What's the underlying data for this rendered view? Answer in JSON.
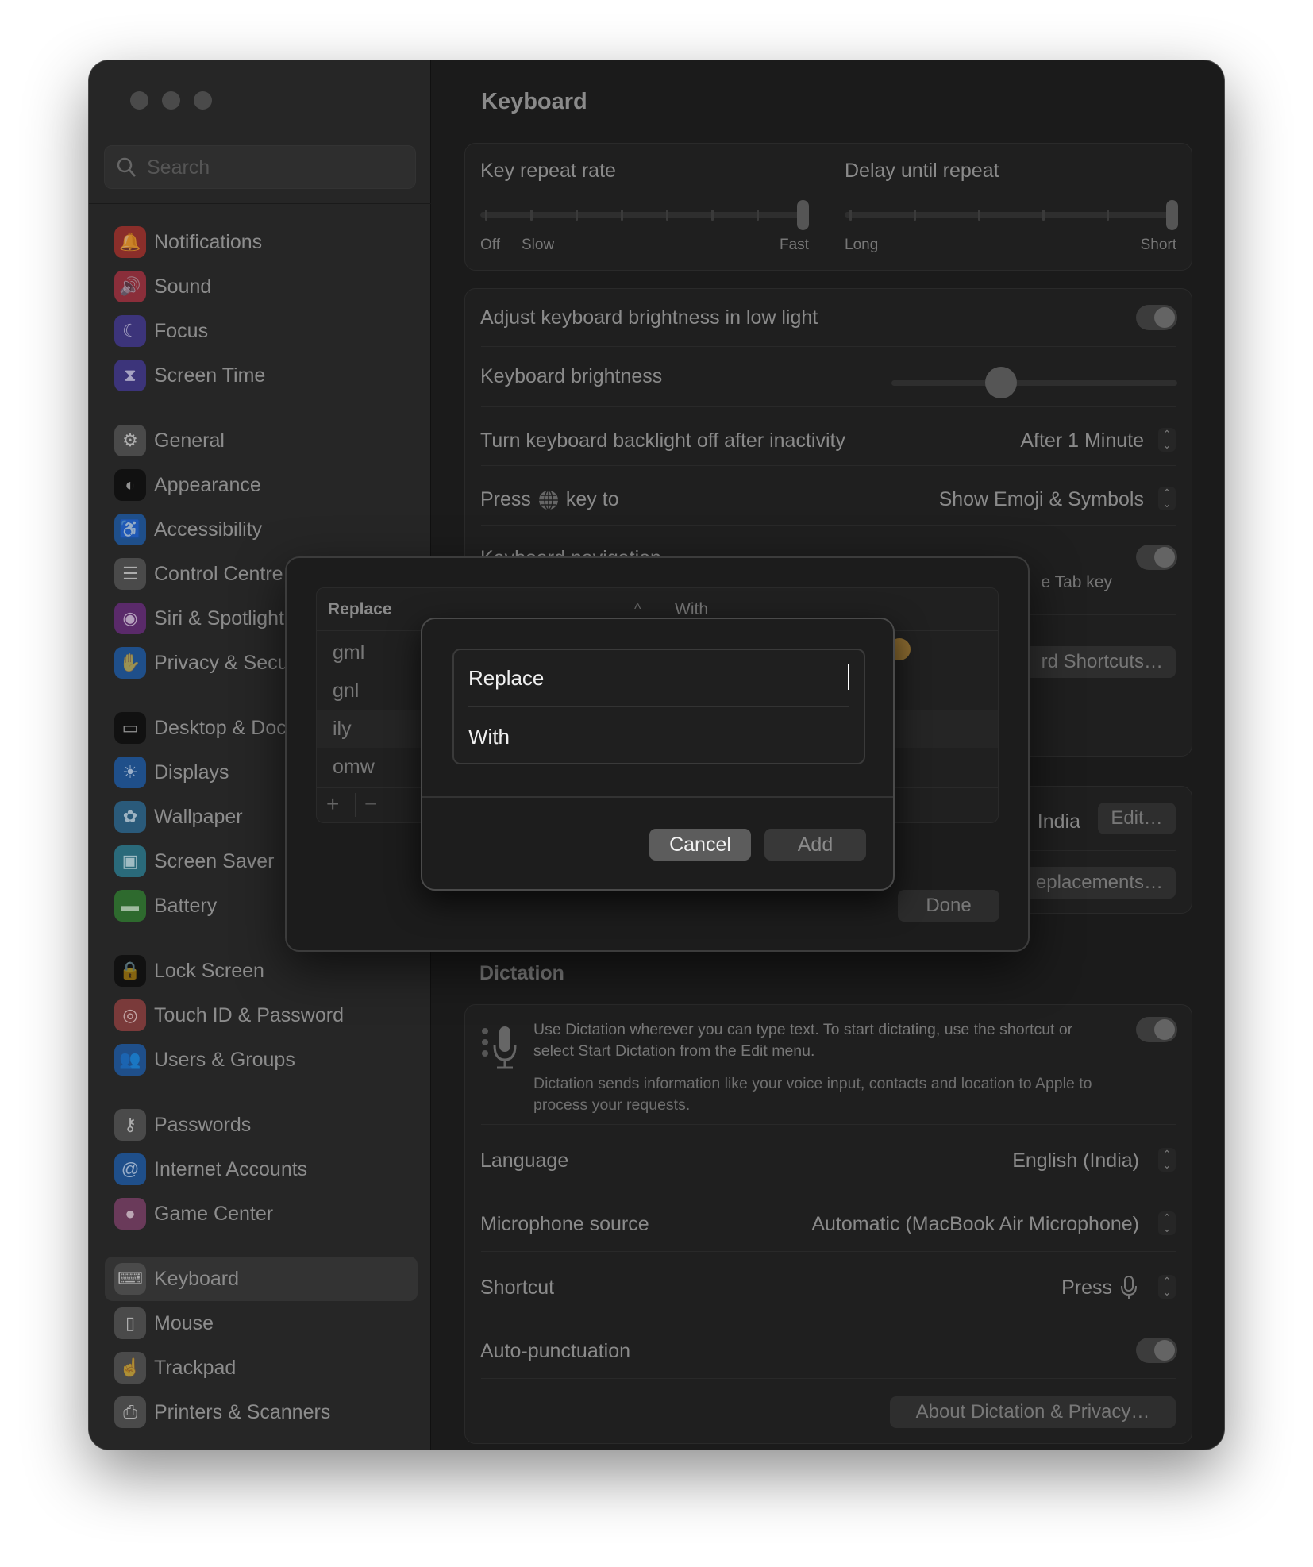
{
  "sidebar": {
    "search_placeholder": "Search",
    "groups": [
      [
        {
          "label": "Notifications",
          "icon": "bell-icon",
          "color": "#8a2e2a",
          "glyph": "🔔"
        },
        {
          "label": "Sound",
          "icon": "speaker-icon",
          "color": "#8a2e3a",
          "glyph": "🔊"
        },
        {
          "label": "Focus",
          "icon": "moon-icon",
          "color": "#3c347a",
          "glyph": "☾"
        },
        {
          "label": "Screen Time",
          "icon": "hourglass-icon",
          "color": "#3c347a",
          "glyph": "⧗"
        }
      ],
      [
        {
          "label": "General",
          "icon": "gear-icon",
          "color": "#4a4a4a",
          "glyph": "⚙"
        },
        {
          "label": "Appearance",
          "icon": "appearance-icon",
          "color": "#111111",
          "glyph": "◐"
        },
        {
          "label": "Accessibility",
          "icon": "accessibility-icon",
          "color": "#1f4f8a",
          "glyph": "♿"
        },
        {
          "label": "Control Centre",
          "icon": "toggles-icon",
          "color": "#4a4a4a",
          "glyph": "☰"
        },
        {
          "label": "Siri & Spotlight",
          "icon": "siri-icon",
          "color": "#5a2a6a",
          "glyph": "◉"
        },
        {
          "label": "Privacy & Security",
          "icon": "hand-icon",
          "color": "#1f4f8a",
          "glyph": "✋"
        }
      ],
      [
        {
          "label": "Desktop & Dock",
          "icon": "dock-icon",
          "color": "#111111",
          "glyph": "▭"
        },
        {
          "label": "Displays",
          "icon": "sun-icon",
          "color": "#1f4f8a",
          "glyph": "☀"
        },
        {
          "label": "Wallpaper",
          "icon": "flower-icon",
          "color": "#2a5a7a",
          "glyph": "✿"
        },
        {
          "label": "Screen Saver",
          "icon": "screensaver-icon",
          "color": "#2a6a7a",
          "glyph": "▣"
        },
        {
          "label": "Battery",
          "icon": "battery-icon",
          "color": "#2e6a2e",
          "glyph": "▬"
        }
      ],
      [
        {
          "label": "Lock Screen",
          "icon": "lock-icon",
          "color": "#111111",
          "glyph": "🔒"
        },
        {
          "label": "Touch ID & Password",
          "icon": "fingerprint-icon",
          "color": "#7a3a3a",
          "glyph": "◎"
        },
        {
          "label": "Users & Groups",
          "icon": "users-icon",
          "color": "#1f4f8a",
          "glyph": "👥"
        }
      ],
      [
        {
          "label": "Passwords",
          "icon": "key-icon",
          "color": "#4a4a4a",
          "glyph": "⚷"
        },
        {
          "label": "Internet Accounts",
          "icon": "at-icon",
          "color": "#1f4f8a",
          "glyph": "@"
        },
        {
          "label": "Game Center",
          "icon": "game-center-icon",
          "color": "#6a3a5a",
          "glyph": "●"
        }
      ],
      [
        {
          "label": "Keyboard",
          "icon": "keyboard-icon",
          "color": "#4a4a4a",
          "glyph": "⌨",
          "selected": true
        },
        {
          "label": "Mouse",
          "icon": "mouse-icon",
          "color": "#4a4a4a",
          "glyph": "▯"
        },
        {
          "label": "Trackpad",
          "icon": "trackpad-icon",
          "color": "#4a4a4a",
          "glyph": "☝"
        },
        {
          "label": "Printers & Scanners",
          "icon": "printer-icon",
          "color": "#4a4a4a",
          "glyph": "⎙"
        }
      ]
    ]
  },
  "main": {
    "title": "Keyboard",
    "key_repeat": {
      "label": "Key repeat rate",
      "min_labels": [
        "Off",
        "Slow"
      ],
      "max_label": "Fast",
      "steps": 8,
      "value_index": 7
    },
    "delay_repeat": {
      "label": "Delay until repeat",
      "min_label": "Long",
      "max_label": "Short",
      "steps": 6,
      "value_index": 5
    },
    "adjust_brightness": {
      "label": "Adjust keyboard brightness in low light",
      "on": true
    },
    "brightness": {
      "label": "Keyboard brightness",
      "value": 0.37
    },
    "backlight_off": {
      "label": "Turn keyboard backlight off after inactivity",
      "value": "After 1 Minute"
    },
    "globe_key": {
      "label_pre": "Press",
      "label_post": "key to",
      "value": "Show Emoji & Symbols"
    },
    "keyboard_navigation": {
      "label": "Keyboard navigation",
      "desc_fragment": "e Tab key",
      "on": true
    },
    "shortcuts_button_fragment": "rd Shortcuts…",
    "input_sources_fragment": "India",
    "edit_button": "Edit…",
    "replacements_button_fragment": "eplacements…",
    "dictation": {
      "heading": "Dictation",
      "desc1": "Use Dictation wherever you can type text. To start dictating, use the shortcut or select Start Dictation from the Edit menu.",
      "desc2": "Dictation sends information like your voice input, contacts and location to Apple to process your requests.",
      "on": true,
      "language_label": "Language",
      "language_value": "English (India)",
      "mic_label": "Microphone source",
      "mic_value": "Automatic (MacBook Air Microphone)",
      "shortcut_label": "Shortcut",
      "shortcut_value": "Press",
      "autopunct_label": "Auto-punctuation",
      "autopunct_on": true,
      "about_button": "About Dictation & Privacy…"
    }
  },
  "replacements_dialog": {
    "col_replace": "Replace",
    "col_with": "With",
    "rows": [
      "gml",
      "gnl",
      "ily",
      "omw"
    ],
    "add": "+",
    "remove": "−",
    "done": "Done"
  },
  "add_sheet": {
    "replace_placeholder": "Replace",
    "with_placeholder": "With",
    "cancel": "Cancel",
    "add": "Add"
  }
}
